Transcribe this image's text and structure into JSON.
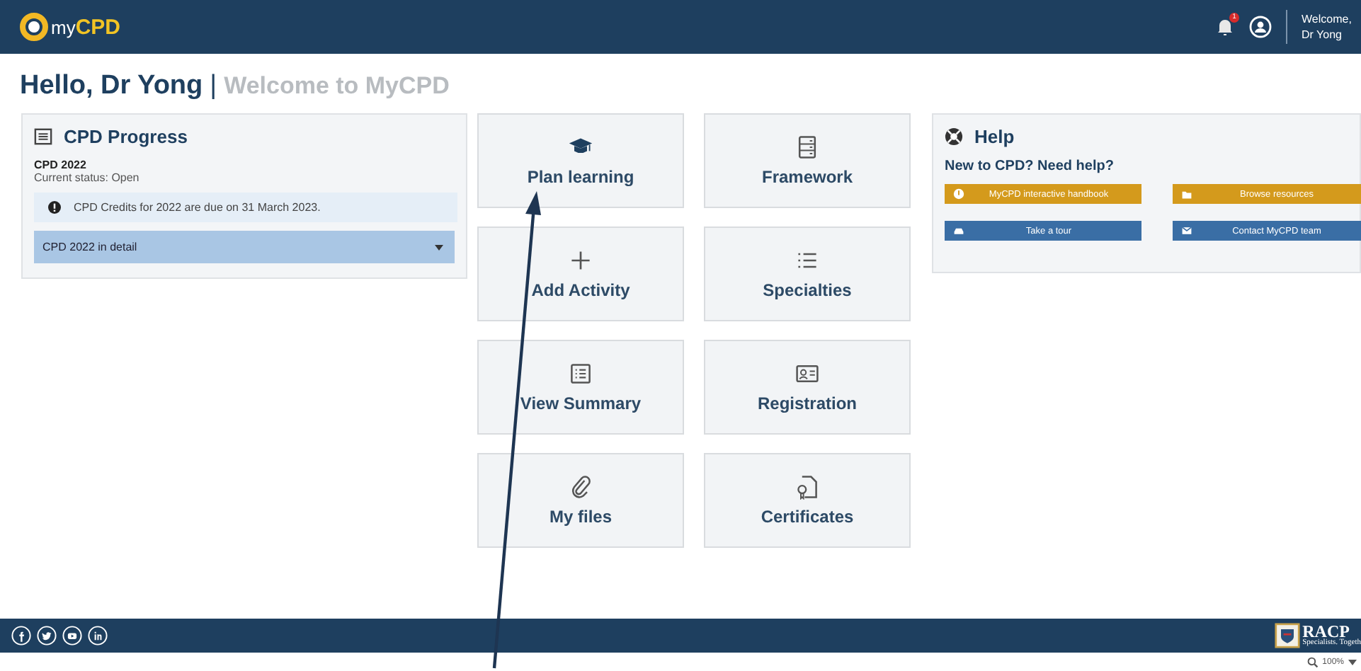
{
  "header": {
    "logo": [
      "my",
      "CPD"
    ],
    "notifications": {
      "count": "1"
    },
    "welcome": [
      "Welcome,",
      "Dr Yong"
    ]
  },
  "greeting": {
    "name": "Hello, Dr Yong",
    "separator": "|",
    "subtitle": "Welcome to MyCPD"
  },
  "progress": {
    "title": "CPD Progress",
    "year": "CPD 2022",
    "status": "Current status: Open",
    "notice": "CPD Credits for 2022 are due on 31 March 2023.",
    "dropdown": "CPD 2022 in detail"
  },
  "tiles": [
    {
      "label": "Plan learning"
    },
    {
      "label": "Framework"
    },
    {
      "label": "Add Activity"
    },
    {
      "label": "Specialties"
    },
    {
      "label": "View Summary"
    },
    {
      "label": "Registration"
    },
    {
      "label": "My files"
    },
    {
      "label": "Certificates"
    }
  ],
  "help": {
    "title": "Help",
    "question": "New to CPD? Need help?",
    "buttons": [
      {
        "label": "MyCPD interactive handbook",
        "color": "#d49a1c"
      },
      {
        "label": "Browse resources",
        "color": "#d49a1c"
      },
      {
        "label": "Take a tour",
        "color": "#3a6ea5"
      },
      {
        "label": "Contact MyCPD team",
        "color": "#3a6ea5"
      }
    ]
  },
  "footer": {
    "brand": "RACP",
    "tagline": "Specialists. Togeth"
  },
  "status_bar": {
    "zoom": "100%"
  }
}
